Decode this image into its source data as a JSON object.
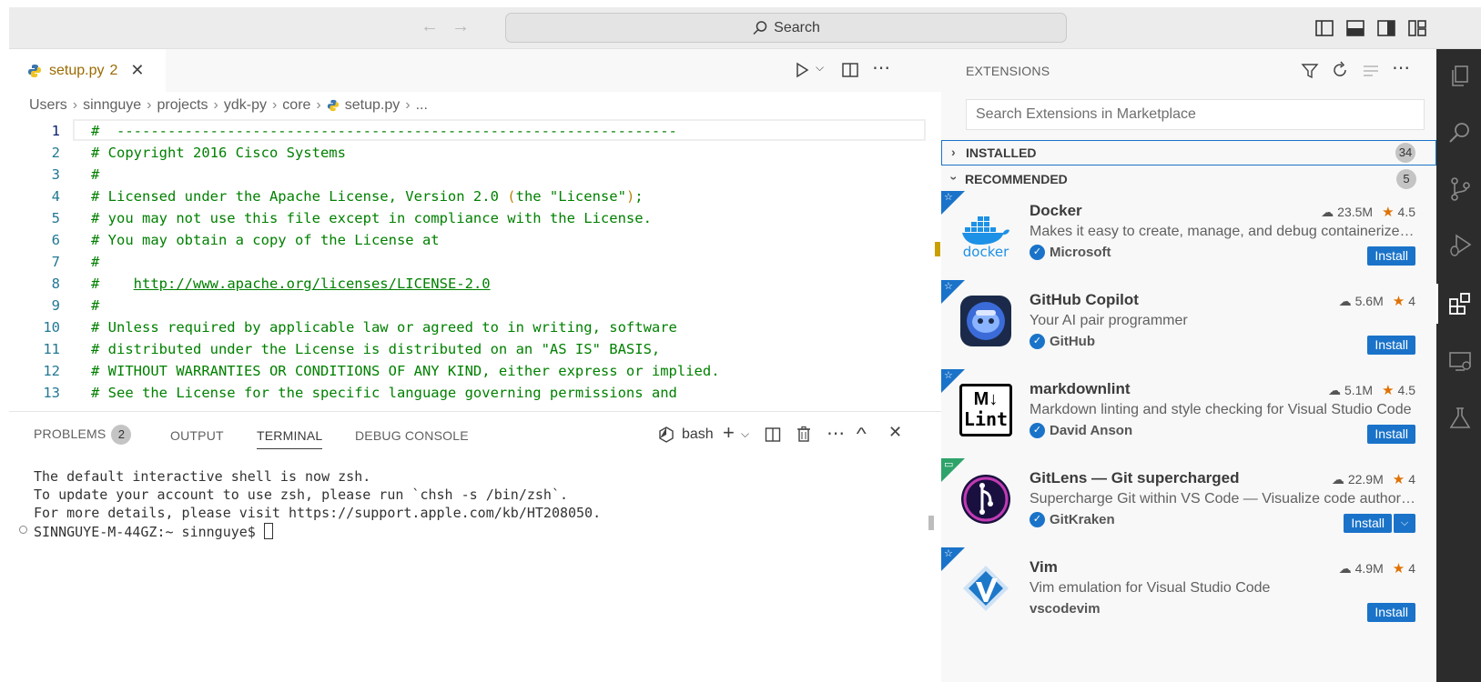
{
  "titlebar": {
    "search_label": "Search"
  },
  "editor": {
    "tab": {
      "filename": "setup.py",
      "problem_count": "2"
    },
    "breadcrumb": [
      "Users",
      "sinnguye",
      "projects",
      "ydk-py",
      "core",
      "setup.py",
      "..."
    ],
    "lines": [
      {
        "n": "1",
        "text": "#  ------------------------------------------------------------------"
      },
      {
        "n": "2",
        "text": "# Copyright 2016 Cisco Systems"
      },
      {
        "n": "3",
        "text": "#"
      },
      {
        "n": "4",
        "text_a": "# Licensed under the Apache License, Version 2.0 ",
        "text_paren_open": "(",
        "text_b": "the \"License\"",
        "text_paren_close": ")",
        "text_c": ";"
      },
      {
        "n": "5",
        "text": "# you may not use this file except in compliance with the License."
      },
      {
        "n": "6",
        "text": "# You may obtain a copy of the License at"
      },
      {
        "n": "7",
        "text": "#"
      },
      {
        "n": "8",
        "text_a": "#    ",
        "link": "http://www.apache.org/licenses/LICENSE-2.0"
      },
      {
        "n": "9",
        "text": "#"
      },
      {
        "n": "10",
        "text": "# Unless required by applicable law or agreed to in writing, software"
      },
      {
        "n": "11",
        "text": "# distributed under the License is distributed on an \"AS IS\" BASIS,"
      },
      {
        "n": "12",
        "text": "# WITHOUT WARRANTIES OR CONDITIONS OF ANY KIND, either express or implied."
      },
      {
        "n": "13",
        "text": "# See the License for the specific language governing permissions and"
      }
    ]
  },
  "panel": {
    "tabs": {
      "problems": "PROBLEMS",
      "problems_count": "2",
      "output": "OUTPUT",
      "terminal": "TERMINAL",
      "debug": "DEBUG CONSOLE"
    },
    "shell_name": "bash",
    "terminal_lines": [
      "The default interactive shell is now zsh.",
      "To update your account to use zsh, please run `chsh -s /bin/zsh`.",
      "For more details, please visit https://support.apple.com/kb/HT208050.",
      "SINNGUYE-M-44GZ:~ sinnguye$ "
    ]
  },
  "extensions": {
    "title": "EXTENSIONS",
    "search_placeholder": "Search Extensions in Marketplace",
    "installed": {
      "label": "INSTALLED",
      "count": "34"
    },
    "recommended": {
      "label": "RECOMMENDED",
      "count": "5"
    },
    "items": [
      {
        "name": "Docker",
        "downloads": "23.5M",
        "rating": "4.5",
        "description": "Makes it easy to create, manage, and debug containerized applications.",
        "publisher": "Microsoft",
        "install": "Install",
        "logo_text": "docker"
      },
      {
        "name": "GitHub Copilot",
        "downloads": "5.6M",
        "rating": "4",
        "description": "Your AI pair programmer",
        "publisher": "GitHub",
        "install": "Install"
      },
      {
        "name": "markdownlint",
        "downloads": "5.1M",
        "rating": "4.5",
        "description": "Markdown linting and style checking for Visual Studio Code",
        "publisher": "David Anson",
        "install": "Install",
        "logo_text_top": "M↓",
        "logo_text_bottom": "Lint"
      },
      {
        "name": "GitLens — Git supercharged",
        "downloads": "22.9M",
        "rating": "4",
        "description": "Supercharge Git within VS Code — Visualize code authorship",
        "publisher": "GitKraken",
        "install": "Install"
      },
      {
        "name": "Vim",
        "downloads": "4.9M",
        "rating": "4",
        "description": "Vim emulation for Visual Studio Code",
        "publisher": "vscodevim",
        "install": "Install"
      }
    ]
  },
  "colors": {
    "accent": "#1a73c9",
    "comment_green": "#008000",
    "activity_bar": "#2c2c2c"
  }
}
